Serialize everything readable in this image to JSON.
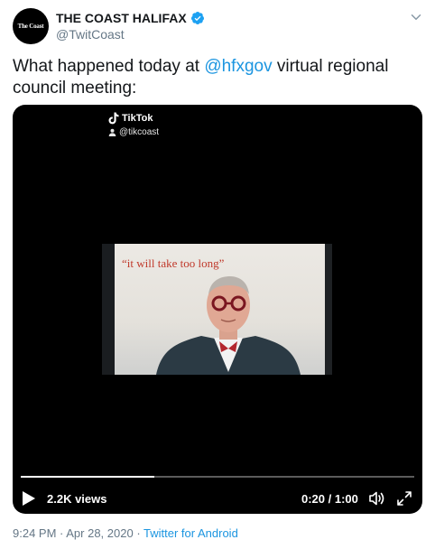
{
  "account": {
    "display_name": "THE COAST HALIFAX",
    "handle": "@TwitCoast",
    "avatar_text": "The Coast",
    "verified": true
  },
  "tweet": {
    "text_before": "What happened today at ",
    "mention": "@hfxgov",
    "text_after": " virtual regional council meeting:"
  },
  "video": {
    "watermark_brand": "TikTok",
    "watermark_handle": "@tikcoast",
    "caption": "“it will take too long”",
    "views": "2.2K views",
    "time": "0:20 / 1:00",
    "progress": 0.34
  },
  "meta": {
    "timestamp": "9:24 PM · Apr 28, 2020",
    "separator": " · ",
    "source": "Twitter for Android"
  },
  "colors": {
    "link": "#1b95e0",
    "verified": "#1da1f2",
    "secondary_text": "#657786"
  },
  "icons": [
    "verified-badge-icon",
    "caret-down-icon",
    "tiktok-note-icon",
    "tiktok-user-icon",
    "play-icon",
    "volume-icon",
    "fullscreen-icon"
  ]
}
